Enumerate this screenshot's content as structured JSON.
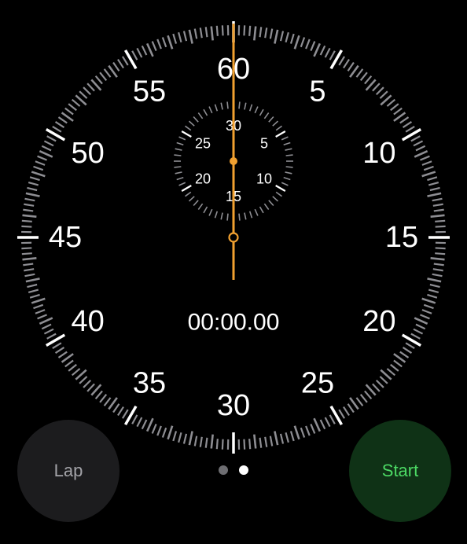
{
  "dial": {
    "numbers": [
      "60",
      "5",
      "10",
      "15",
      "20",
      "25",
      "30",
      "35",
      "40",
      "45",
      "50",
      "55"
    ],
    "tick_color": "#8e8e93",
    "major_tick_color": "#ffffff"
  },
  "subdial": {
    "numbers": [
      "30",
      "5",
      "10",
      "15",
      "20",
      "25"
    ]
  },
  "hand": {
    "color": "#f0a030"
  },
  "elapsed": "00:00.00",
  "buttons": {
    "lap_label": "Lap",
    "start_label": "Start"
  },
  "page_indicator": {
    "count": 2,
    "active_index": 1,
    "active_color": "#ffffff",
    "inactive_color": "#6e6e72"
  }
}
